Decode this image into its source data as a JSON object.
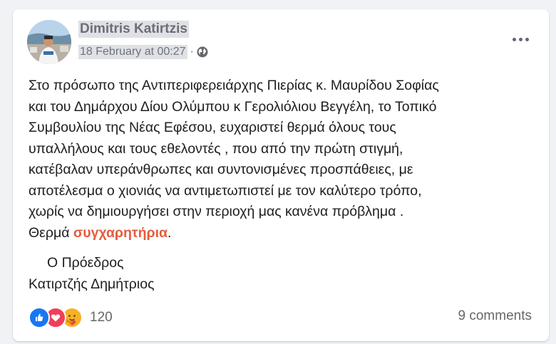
{
  "post": {
    "author": "Dimitris Katirtzis",
    "timestamp": "18 February at 00:27",
    "separator": "·",
    "privacy_icon": "globe-icon",
    "menu_icon": "more-options-icon",
    "text_lines": [
      "Στο πρόσωπο της Αντιπεριφερειάρχης Πιερίας κ. Μαυρίδου Σοφίας",
      "και του Δημάρχου Δίου Ολύμπου κ Γερολιόλιου Βεγγέλη, το Τοπικό",
      "Συμβουλίου της Νέας Εφέσου, ευχαριστεί θερμά όλους τους",
      "υπαλλήλους και τους εθελοντές , που από την πρώτη στιγμή,",
      "κατέβαλαν  υπεράνθρωπες και συντονισμένες  προσπάθειες,  με",
      "αποτέλεσμα ο χιονιάς να αντιμετωπιστεί με τον καλύτερο τρόπο,",
      "χωρίς να δημιουργήσει στην περιοχή μας κανένα πρόβλημα ."
    ],
    "last_line_prefix": "Θερμά ",
    "highlight_word": "συγχαρητήρια",
    "last_line_suffix": ".",
    "signature_title": "Ο Πρόεδρος",
    "signature_name": "Κατιρτζής Δημήτριος"
  },
  "footer": {
    "reaction_icons": [
      "like-icon",
      "love-icon",
      "care-icon"
    ],
    "reaction_count": "120",
    "comments": "9 comments"
  },
  "colors": {
    "highlight": "#e65c3c",
    "like": "#1877f2",
    "love": "#f33e58",
    "care": "#f7b125"
  }
}
